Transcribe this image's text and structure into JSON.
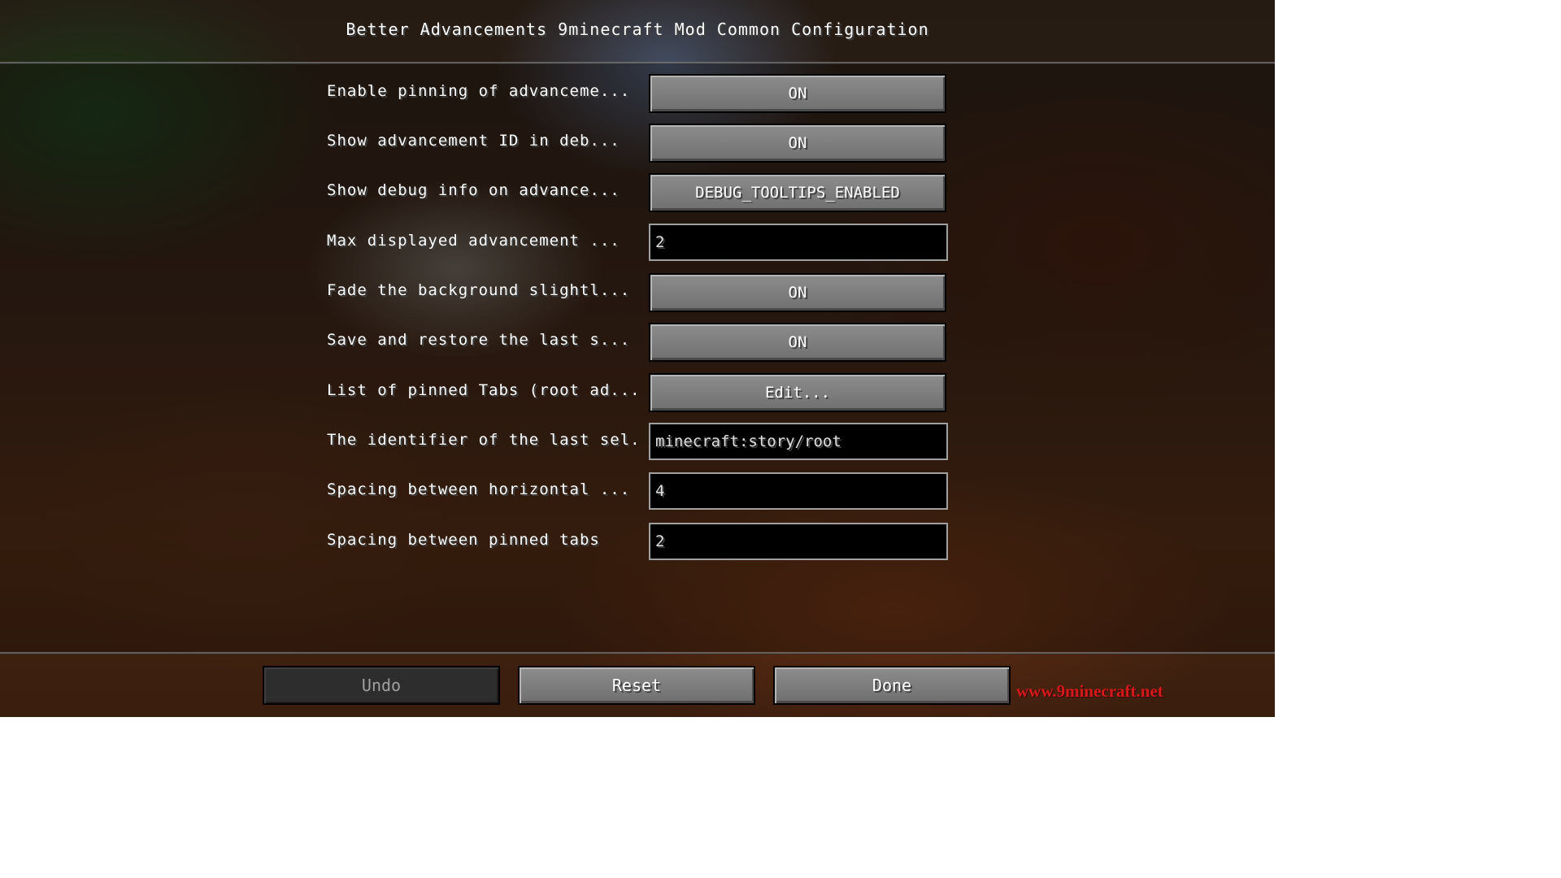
{
  "screen": {
    "title": "Better Advancements 9minecraft Mod Common Configuration"
  },
  "options": [
    {
      "label": "Enable pinning of advanceme...",
      "type": "button",
      "value": "ON"
    },
    {
      "label": "Show advancement ID in deb...",
      "type": "button",
      "value": "ON"
    },
    {
      "label": "Show debug info on advance...",
      "type": "button",
      "value": "DEBUG_TOOLTIPS_ENABLED"
    },
    {
      "label": "Max displayed advancement ...",
      "type": "field",
      "value": "2"
    },
    {
      "label": "Fade the background slightl...",
      "type": "button",
      "value": "ON"
    },
    {
      "label": "Save and restore the last s...",
      "type": "button",
      "value": "ON"
    },
    {
      "label": "List of pinned Tabs (root ad...",
      "type": "button",
      "value": "Edit..."
    },
    {
      "label": "The identifier of the last sel...",
      "type": "field",
      "value": "minecraft:story/root"
    },
    {
      "label": "Spacing between horizontal ...",
      "type": "field",
      "value": "4"
    },
    {
      "label": "Spacing between pinned tabs",
      "type": "field",
      "value": "2"
    }
  ],
  "footer": {
    "undo_label": "Undo",
    "undo_enabled": false,
    "reset_label": "Reset",
    "done_label": "Done"
  },
  "watermark": "www.9minecraft.net"
}
